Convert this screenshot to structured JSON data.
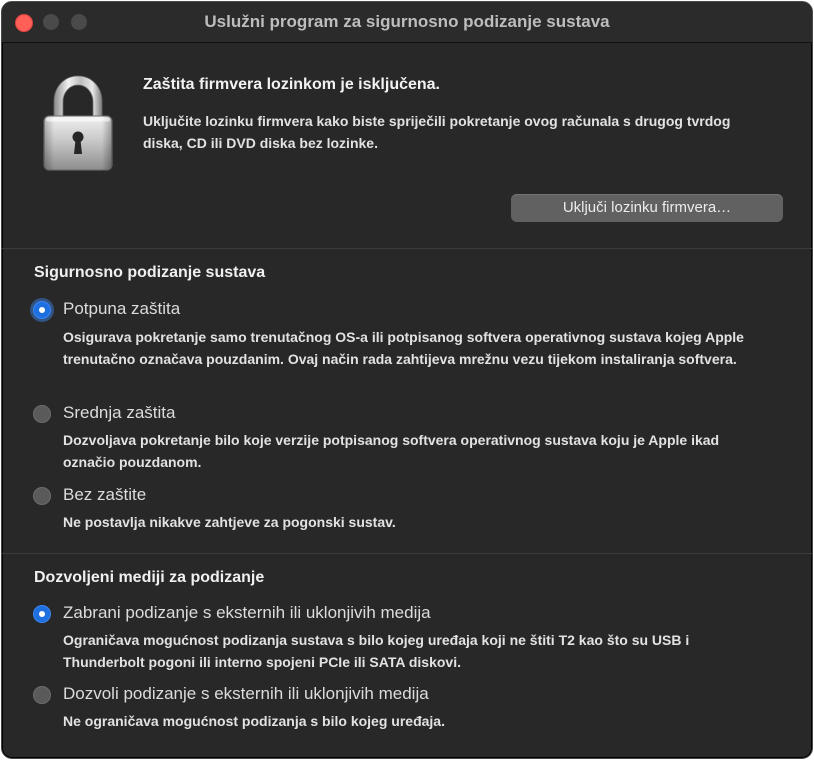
{
  "window": {
    "title": "Uslužni program za sigurnosno podizanje sustava"
  },
  "firmware": {
    "icon": "padlock-icon",
    "heading": "Zaštita firmvera lozinkom je isključena.",
    "description": "Uključite lozinku firmvera kako biste spriječili pokretanje ovog računala s drugog tvrdog diska, CD ili DVD diska bez lozinke.",
    "button_label": "Uključi lozinku firmvera…"
  },
  "secure_boot": {
    "title": "Sigurnosno podizanje sustava",
    "options": [
      {
        "label": "Potpuna zaštita",
        "description": "Osigurava pokretanje samo trenutačnog OS-a ili potpisanog softvera operativnog sustava kojeg Apple trenutačno označava pouzdanim. Ovaj način rada zahtijeva mrežnu vezu tijekom instaliranja softvera.",
        "selected": true
      },
      {
        "label": "Srednja zaštita",
        "description": "Dozvoljava pokretanje bilo koje verzije potpisanog softvera operativnog sustava koju je Apple ikad označio pouzdanom.",
        "selected": false
      },
      {
        "label": "Bez zaštite",
        "description": "Ne postavlja nikakve zahtjeve za pogonski sustav.",
        "selected": false
      }
    ]
  },
  "boot_media": {
    "title": "Dozvoljeni mediji za podizanje",
    "options": [
      {
        "label": "Zabrani podizanje s eksternih ili uklonjivih medija",
        "description": "Ograničava mogućnost podizanja sustava s bilo kojeg uređaja koji ne štiti T2 kao što su USB i Thunderbolt pogoni ili interno spojeni PCIe ili SATA diskovi.",
        "selected": true
      },
      {
        "label": "Dozvoli podizanje s eksternih ili uklonjivih medija",
        "description": "Ne ograničava mogućnost podizanja s bilo kojeg uređaja.",
        "selected": false
      }
    ]
  },
  "colors": {
    "window_bg": "#282828",
    "accent": "#1e6fe0",
    "close_button": "#ff5f57"
  }
}
